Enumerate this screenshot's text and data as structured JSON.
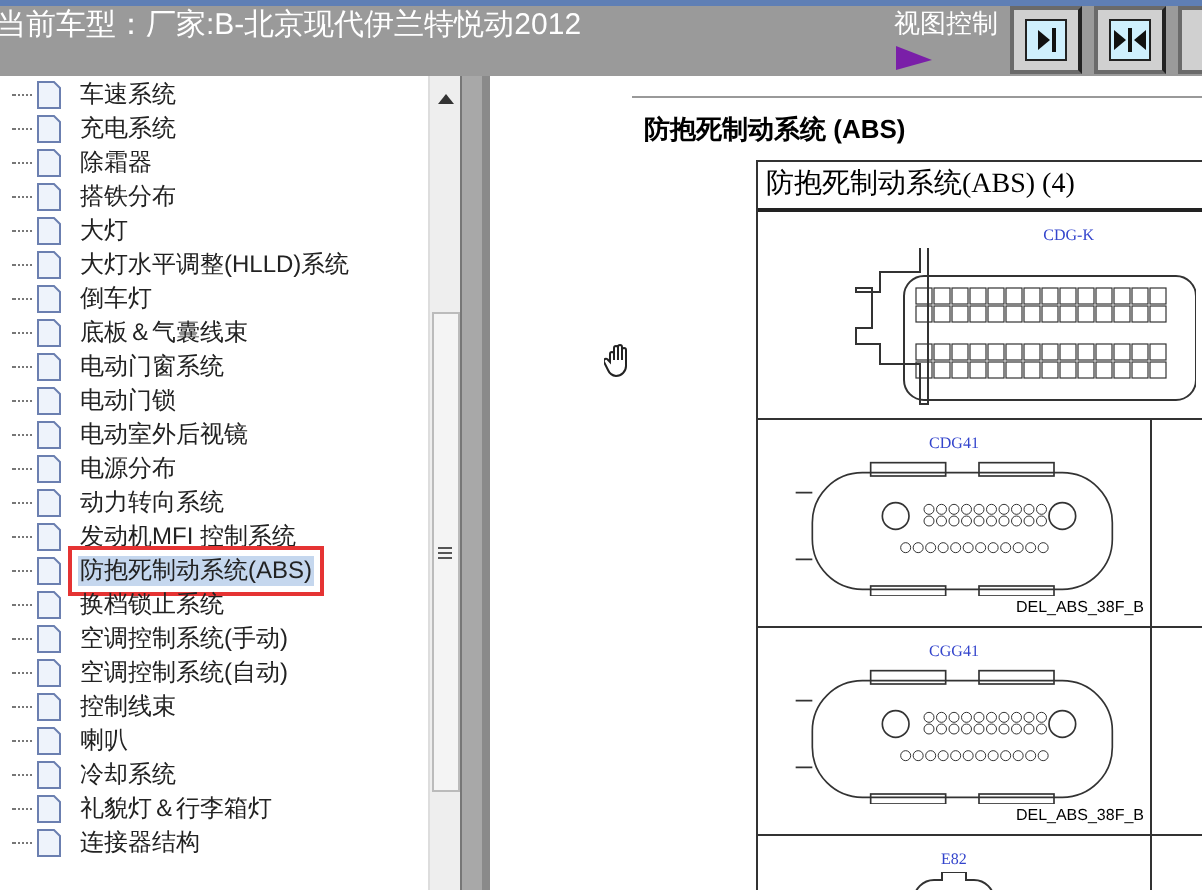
{
  "header": {
    "title": "当前车型：厂家:B-北京现代伊兰特悦动2012",
    "view_control": {
      "label": "视图控制"
    }
  },
  "tree": {
    "items": [
      {
        "label": "车速系统",
        "selected": false
      },
      {
        "label": "充电系统",
        "selected": false
      },
      {
        "label": "除霜器",
        "selected": false
      },
      {
        "label": "搭铁分布",
        "selected": false
      },
      {
        "label": "大灯",
        "selected": false
      },
      {
        "label": "大灯水平调整(HLLD)系统",
        "selected": false
      },
      {
        "label": "倒车灯",
        "selected": false
      },
      {
        "label": "底板＆气囊线束",
        "selected": false
      },
      {
        "label": "电动门窗系统",
        "selected": false
      },
      {
        "label": "电动门锁",
        "selected": false
      },
      {
        "label": "电动室外后视镜",
        "selected": false
      },
      {
        "label": "电源分布",
        "selected": false
      },
      {
        "label": "动力转向系统",
        "selected": false
      },
      {
        "label": "发动机MFI 控制系统",
        "selected": false
      },
      {
        "label": "防抱死制动系统(ABS)",
        "selected": true
      },
      {
        "label": "换档锁止系统",
        "selected": false
      },
      {
        "label": "空调控制系统(手动)",
        "selected": false
      },
      {
        "label": "空调控制系统(自动)",
        "selected": false
      },
      {
        "label": "控制线束",
        "selected": false
      },
      {
        "label": "喇叭",
        "selected": false
      },
      {
        "label": "冷却系统",
        "selected": false
      },
      {
        "label": "礼貌灯＆行李箱灯",
        "selected": false
      },
      {
        "label": "连接器结构",
        "selected": false
      }
    ]
  },
  "document": {
    "heading": "防抱死制动系统 (ABS)",
    "table_title": "防抱死制动系统(ABS) (4)",
    "connectors": [
      {
        "kind": "ecu",
        "code": "CDG-K"
      },
      {
        "kind": "round",
        "code": "CDG41",
        "part": "DEL_ABS_38F_B"
      },
      {
        "kind": "round",
        "code": "CGG41",
        "part": "DEL_ABS_38F_B"
      },
      {
        "kind": "small",
        "code": "E82"
      }
    ]
  }
}
